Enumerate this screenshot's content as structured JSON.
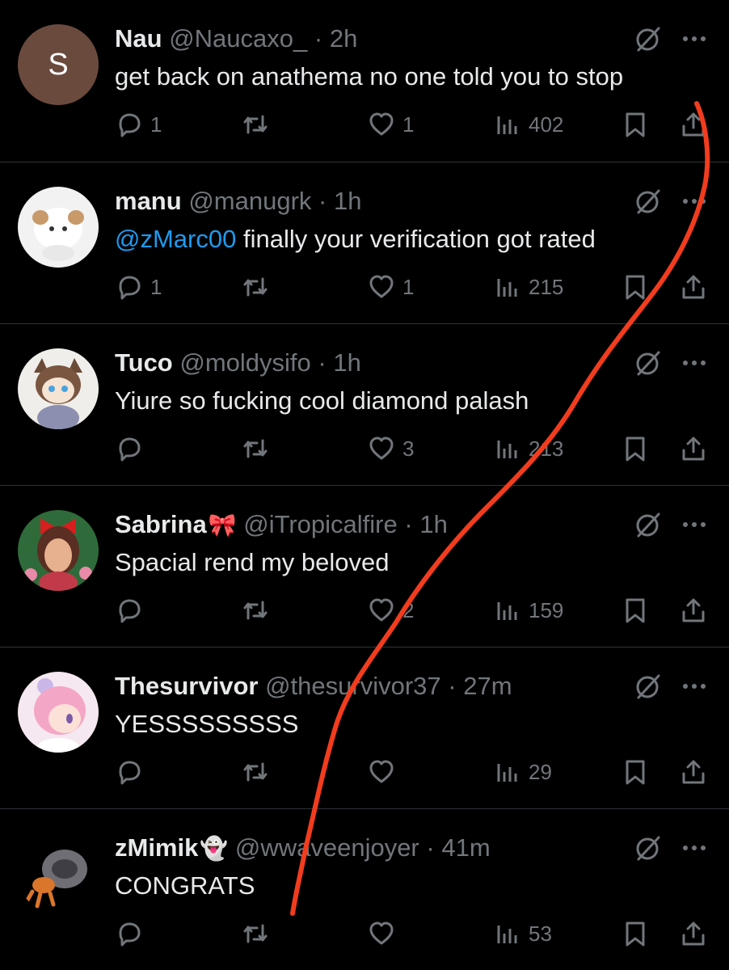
{
  "tweets": [
    {
      "name": "Nau",
      "emoji": "",
      "handle": "@Naucaxo_",
      "time": "2h",
      "mention": "",
      "text": "get back on anathema no one told you to stop",
      "avatar": {
        "type": "initial",
        "letter": "S",
        "color": "#6b4a3e"
      },
      "replies": "1",
      "retweets": "",
      "likes": "1",
      "views": "402"
    },
    {
      "name": "manu",
      "emoji": "",
      "handle": "@manugrk",
      "time": "1h",
      "mention": "@zMarc00",
      "text": " finally your verification got rated",
      "avatar": {
        "type": "image",
        "color": "#f2f2f2"
      },
      "replies": "1",
      "retweets": "",
      "likes": "1",
      "views": "215"
    },
    {
      "name": "Tuco",
      "emoji": "",
      "handle": "@moldysifo",
      "time": "1h",
      "mention": "",
      "text": "Yiure so fucking cool diamond palash",
      "avatar": {
        "type": "image",
        "color": "#f0eeea"
      },
      "replies": "",
      "retweets": "",
      "likes": "3",
      "views": "213"
    },
    {
      "name": "Sabrina",
      "emoji": "🎀",
      "handle": "@iTropicalfire",
      "time": "1h",
      "mention": "",
      "text": "Spacial rend my beloved",
      "avatar": {
        "type": "image",
        "color": "#2f6b3a"
      },
      "replies": "",
      "retweets": "",
      "likes": "2",
      "views": "159"
    },
    {
      "name": "Thesurvivor",
      "emoji": "",
      "handle": "@thesurvivor37",
      "time": "27m",
      "mention": "",
      "text": "YESSSSSSSSS",
      "avatar": {
        "type": "image",
        "color": "#f6e8f0"
      },
      "replies": "",
      "retweets": "",
      "likes": "",
      "views": "29"
    },
    {
      "name": "zMimik",
      "emoji": "👻",
      "handle": "@wwaveenjoyer",
      "time": "41m",
      "mention": "",
      "text": "CONGRATS",
      "avatar": {
        "type": "image",
        "color": "#000000"
      },
      "replies": "",
      "retweets": "",
      "likes": "",
      "views": "53"
    }
  ],
  "separator": "·",
  "colors": {
    "background": "#000000",
    "primary_text": "#e7e9ea",
    "secondary_text": "#71767b",
    "mention": "#1d9bf0",
    "annotation_line": "#f23c1e"
  },
  "icons": [
    "reply-icon",
    "retweet-icon",
    "like-icon",
    "views-icon",
    "bookmark-icon",
    "share-icon",
    "grok-icon",
    "more-icon"
  ]
}
